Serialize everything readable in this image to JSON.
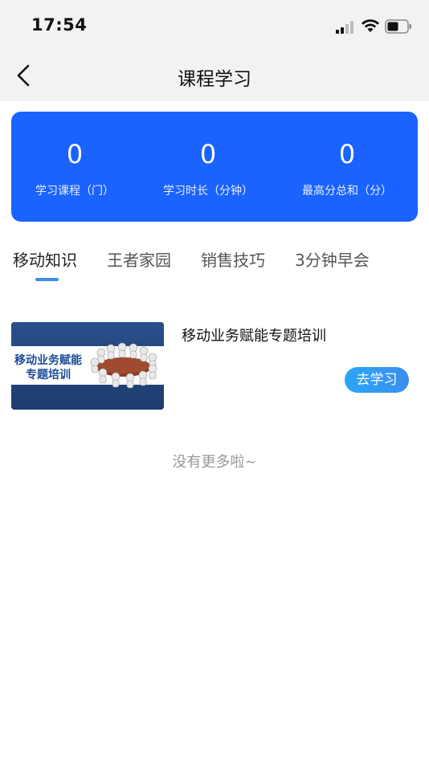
{
  "status_bar": {
    "time": "17:54",
    "icons": [
      "signal-icon",
      "wifi-icon",
      "battery-icon"
    ]
  },
  "nav": {
    "title": "课程学习",
    "back_icon": "chevron-left-icon"
  },
  "stats": {
    "courses": {
      "value": "0",
      "label": "学习课程（门）"
    },
    "duration": {
      "value": "0",
      "label": "学习时长（分钟）"
    },
    "top_score": {
      "value": "0",
      "label": "最高分总和（分）"
    },
    "card_color": "#1a63ff"
  },
  "tabs": [
    {
      "label": "移动知识",
      "active": true
    },
    {
      "label": "王者家园",
      "active": false
    },
    {
      "label": "销售技巧",
      "active": false
    },
    {
      "label": "3分钟早会",
      "active": false
    }
  ],
  "courses": [
    {
      "title": "移动业务赋能专题培训",
      "thumbnail_text_line1": "移动业务赋能",
      "thumbnail_text_line2": "专题培训",
      "action_label": "去学习"
    }
  ],
  "footer": {
    "no_more": "没有更多啦~"
  },
  "colors": {
    "accent": "#3d8cf2",
    "button_gradient_start": "#2aa6f6",
    "button_gradient_end": "#3b8ef0"
  }
}
